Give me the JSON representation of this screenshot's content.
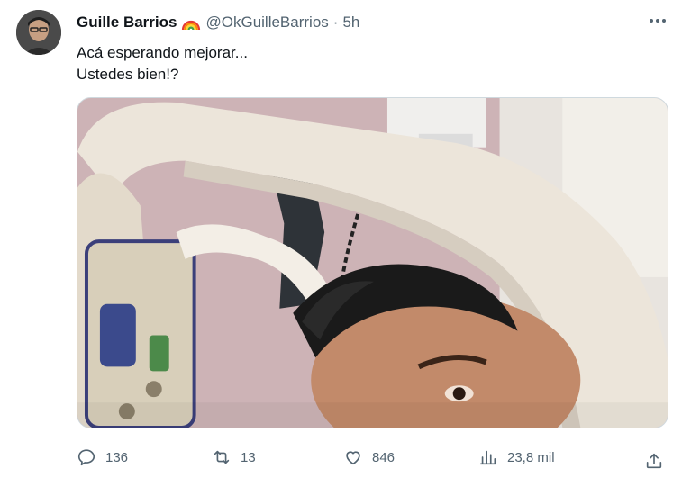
{
  "tweet": {
    "author_name": "Guille Barrios",
    "handle": "@OkGuilleBarrios",
    "separator": "·",
    "time": "5h",
    "text_lines": [
      "Acá esperando mejorar...",
      "Ustedes bien!?"
    ],
    "more_icon": "more-horizontal-icon",
    "badge_icon": "rainbow-emoji",
    "media_description_icon": "photo"
  },
  "actions": {
    "reply_count": "136",
    "retweet_count": "13",
    "like_count": "846",
    "views_count": "23,8 mil"
  },
  "colors": {
    "secondary_text": "#536471",
    "primary_text": "#0f1419",
    "border": "#cfd9de"
  }
}
